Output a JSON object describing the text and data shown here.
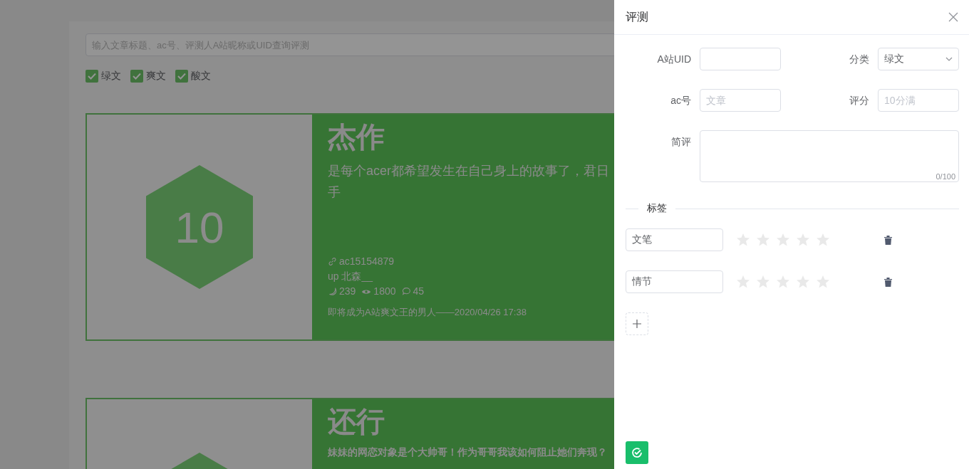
{
  "search": {
    "placeholder": "输入文章标题、ac号、评测人A站昵称或UID查询评测"
  },
  "filters": [
    {
      "label": "绿文",
      "checked": true
    },
    {
      "label": "爽文",
      "checked": true
    },
    {
      "label": "酸文",
      "checked": true
    }
  ],
  "reviews": [
    {
      "score": "10",
      "title": "杰作",
      "description_lines": [
        "是每个acer都希望发生在自己身上的故事了，君日",
        "手"
      ],
      "ac": "ac15154879",
      "author": "up 北森__",
      "likes": "239",
      "views": "1800",
      "comments": "45",
      "reviewer_line": "即将成为A站爽文王的男人——2020/04/26 17:38"
    },
    {
      "title": "还行",
      "subtitle": "妹妹的网恋对象是个大帅哥！作为哥哥我该如何阻止她们奔现？"
    }
  ],
  "drawer": {
    "title": "评测",
    "fields": [
      {
        "label": "A站UID",
        "kind": "input"
      },
      {
        "label": "分类",
        "kind": "select",
        "value": "绿文"
      },
      {
        "label": "ac号",
        "kind": "input",
        "placeholder": "文章"
      },
      {
        "label": "评分",
        "kind": "input",
        "placeholder": "10分满"
      },
      {
        "label": "简评",
        "kind": "textarea",
        "counter": "0/100"
      }
    ],
    "tags_heading": "标签",
    "tags": [
      {
        "name": "文笔",
        "stars": 0
      },
      {
        "name": "情节",
        "stars": 0
      }
    ]
  }
}
